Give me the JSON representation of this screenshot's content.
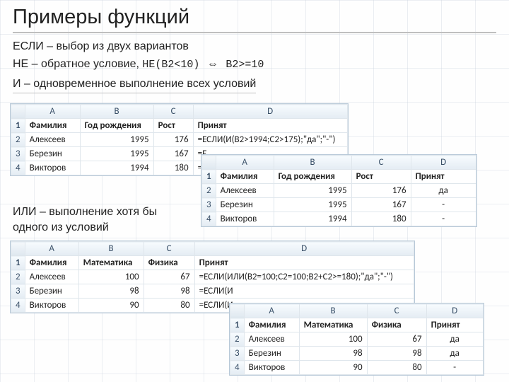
{
  "title": "Примеры функций",
  "line_esli_fn": "ЕСЛИ",
  "line_esli_rest": " – выбор из двух вариантов",
  "line_ne_fn": "НЕ",
  "line_ne_rest": " – обратное условие,",
  "ne_code1": "НЕ(B2<10)",
  "arrow": "⇔",
  "ne_code2": "B2>=10",
  "line_i_fn": "И",
  "line_i_rest": " – одновременное выполнение всех условий",
  "line_ili_fn": "ИЛИ",
  "line_ili_rest": " – выполнение хотя бы одного из условий",
  "sheet1": {
    "cols": [
      "A",
      "B",
      "C",
      "D"
    ],
    "header": [
      "Фамилия",
      "Год рождения",
      "Рост",
      "Принят"
    ],
    "rows": [
      [
        "Алексеев",
        "1995",
        "176",
        "=ЕСЛИ(И(B2>1994;C2>175);\"да\";\"-\")"
      ],
      [
        "Березин",
        "1995",
        "167",
        "=Е"
      ],
      [
        "Викторов",
        "1994",
        "180",
        "=Е"
      ]
    ]
  },
  "sheet2": {
    "cols": [
      "A",
      "B",
      "C",
      "D"
    ],
    "header": [
      "Фамилия",
      "Год рождения",
      "Рост",
      "Принят"
    ],
    "rows": [
      [
        "Алексеев",
        "1995",
        "176",
        "да"
      ],
      [
        "Березин",
        "1995",
        "167",
        "-"
      ],
      [
        "Викторов",
        "1994",
        "180",
        "-"
      ]
    ]
  },
  "sheet3": {
    "cols": [
      "A",
      "B",
      "C",
      "D"
    ],
    "header": [
      "Фамилия",
      "Математика",
      "Физика",
      "Принят"
    ],
    "rows": [
      [
        "Алексеев",
        "100",
        "67",
        "=ЕСЛИ(ИЛИ(B2=100;C2=100;B2+C2>=180);\"да\";\"-\")"
      ],
      [
        "Березин",
        "98",
        "98",
        "=ЕСЛИ(И"
      ],
      [
        "Викторов",
        "90",
        "80",
        "=ЕСЛИ(И"
      ]
    ]
  },
  "sheet4": {
    "cols": [
      "A",
      "B",
      "C",
      "D"
    ],
    "header": [
      "Фамилия",
      "Математика",
      "Физика",
      "Принят"
    ],
    "rows": [
      [
        "Алексеев",
        "100",
        "67",
        "да"
      ],
      [
        "Березин",
        "98",
        "98",
        "да"
      ],
      [
        "Викторов",
        "90",
        "80",
        "-"
      ]
    ]
  }
}
